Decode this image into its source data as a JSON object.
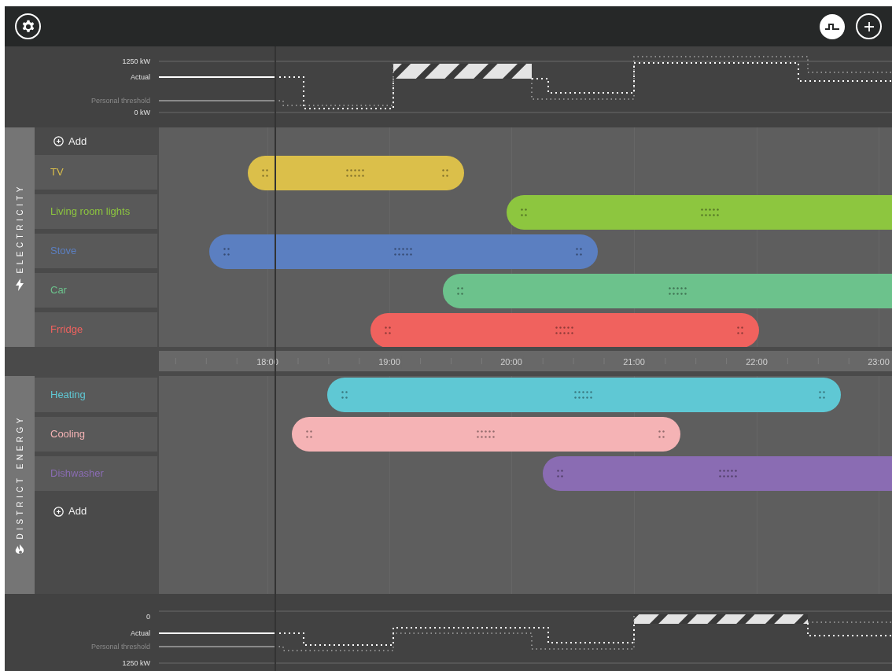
{
  "top_chart": {
    "labels": [
      {
        "text": "1250 kW",
        "kind": "axis"
      },
      {
        "text": "Actual",
        "kind": "actual"
      },
      {
        "text": "Personal threshold",
        "kind": "threshold"
      },
      {
        "text": "0 kW",
        "kind": "axis"
      }
    ]
  },
  "sections": [
    {
      "kind": "electricity",
      "title": "ELECTRICITY",
      "add_label": "Add",
      "devices": [
        {
          "name": "TV",
          "color": "#dbbf4a"
        },
        {
          "name": "Living room lights",
          "color": "#8dc63f"
        },
        {
          "name": "Stove",
          "color": "#5b7fc1"
        },
        {
          "name": "Car",
          "color": "#6cc28c"
        },
        {
          "name": "Frridge",
          "color": "#f0625e"
        }
      ]
    },
    {
      "kind": "district",
      "title": "DISTRICT ENERGY",
      "add_label": "Add",
      "devices": [
        {
          "name": "Heating",
          "color": "#5fc8d4"
        },
        {
          "name": "Cooling",
          "color": "#f5b3b5"
        },
        {
          "name": "Dishwasher",
          "color": "#8a6cb3"
        }
      ]
    }
  ],
  "time_axis": [
    "18:00",
    "19:00",
    "20:00",
    "21:00",
    "22:00",
    "23:00"
  ],
  "bottom_chart": {
    "labels": [
      {
        "text": "0",
        "kind": "axis"
      },
      {
        "text": "Actual",
        "kind": "actual"
      },
      {
        "text": "Personal threshold",
        "kind": "threshold"
      },
      {
        "text": "1250 kW",
        "kind": "axis"
      }
    ]
  }
}
